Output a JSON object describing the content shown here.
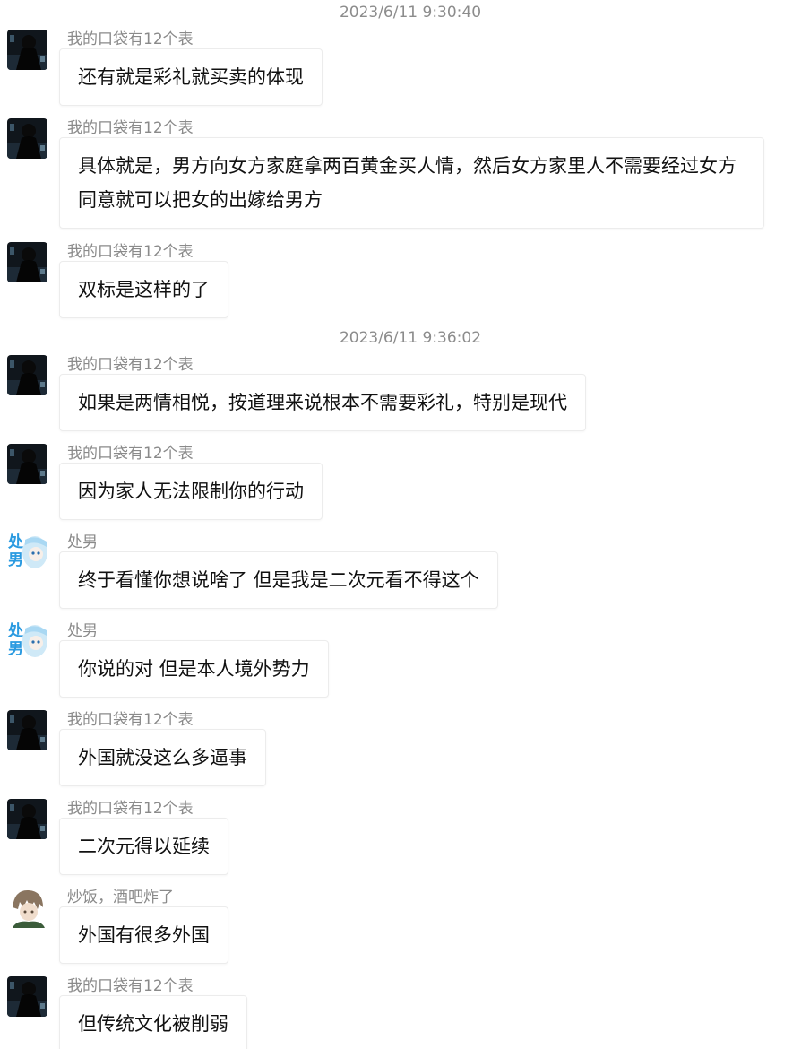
{
  "messages": [
    {
      "type": "message",
      "sender": "我的口袋有12个表",
      "avatar": "dark-figure-avatar-icon",
      "text": "还有就是彩礼就买卖的体现"
    },
    {
      "type": "message",
      "sender": "我的口袋有12个表",
      "avatar": "dark-figure-avatar-icon",
      "text": "具体就是，男方向女方家庭拿两百黄金买人情，然后女方家里人不需要经过女方同意就可以把女的出嫁给男方"
    },
    {
      "type": "message",
      "sender": "我的口袋有12个表",
      "avatar": "dark-figure-avatar-icon",
      "text": "双标是这样的了"
    },
    {
      "type": "message",
      "sender": "我的口袋有12个表",
      "avatar": "dark-figure-avatar-icon",
      "text": "如果是两情相悦，按道理来说根本不需要彩礼，特别是现代"
    },
    {
      "type": "message",
      "sender": "我的口袋有12个表",
      "avatar": "dark-figure-avatar-icon",
      "text": "因为家人无法限制你的行动"
    },
    {
      "type": "message",
      "sender": "处男",
      "avatar": "anime-girl-avatar-icon",
      "avatar_text": "处男",
      "text": "终于看懂你想说啥了 但是我是二次元看不得这个"
    },
    {
      "type": "message",
      "sender": "处男",
      "avatar": "anime-girl-avatar-icon",
      "avatar_text": "处男",
      "text": "你说的对 但是本人境外势力"
    },
    {
      "type": "message",
      "sender": "我的口袋有12个表",
      "avatar": "dark-figure-avatar-icon",
      "text": "外国就没这么多逼事"
    },
    {
      "type": "message",
      "sender": "我的口袋有12个表",
      "avatar": "dark-figure-avatar-icon",
      "text": "二次元得以延续"
    },
    {
      "type": "message",
      "sender": "炒饭，酒吧炸了",
      "avatar": "anime-boy-avatar-icon",
      "text": "外国有很多外国"
    },
    {
      "type": "message",
      "sender": "我的口袋有12个表",
      "avatar": "dark-figure-avatar-icon",
      "text": "但传统文化被削弱"
    }
  ],
  "timestamps": [
    "2023/6/11 9:30:40",
    "2023/6/11 9:36:02"
  ],
  "colors": {
    "background": "#ffffff",
    "sender_name": "#8a8a8a",
    "timestamp": "#8c8c8c",
    "bubble_border": "#ececec",
    "message_text": "#111111",
    "avatar_text_blue": "#2a9ae0"
  }
}
